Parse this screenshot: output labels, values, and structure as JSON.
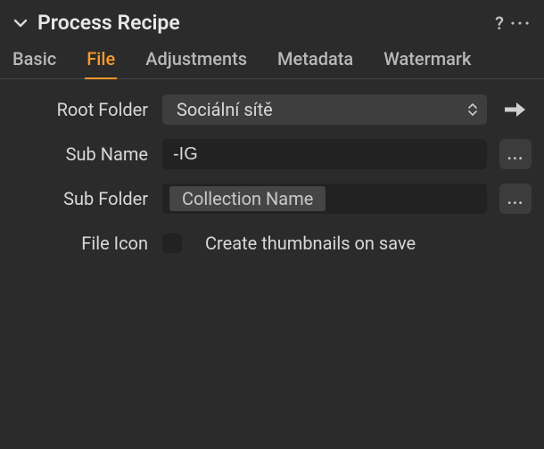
{
  "header": {
    "title": "Process Recipe",
    "help": "?",
    "more": "···"
  },
  "tabs": [
    {
      "label": "Basic",
      "active": false
    },
    {
      "label": "File",
      "active": true
    },
    {
      "label": "Adjustments",
      "active": false
    },
    {
      "label": "Metadata",
      "active": false
    },
    {
      "label": "Watermark",
      "active": false
    }
  ],
  "form": {
    "root_folder": {
      "label": "Root Folder",
      "value": "Sociální sítě"
    },
    "sub_name": {
      "label": "Sub Name",
      "value": "-IG"
    },
    "sub_folder": {
      "label": "Sub Folder",
      "token": "Collection Name"
    },
    "file_icon": {
      "label": "File Icon",
      "checkbox_label": "Create thumbnails on save",
      "checked": false
    }
  },
  "icons": {
    "ellipsis": "..."
  }
}
